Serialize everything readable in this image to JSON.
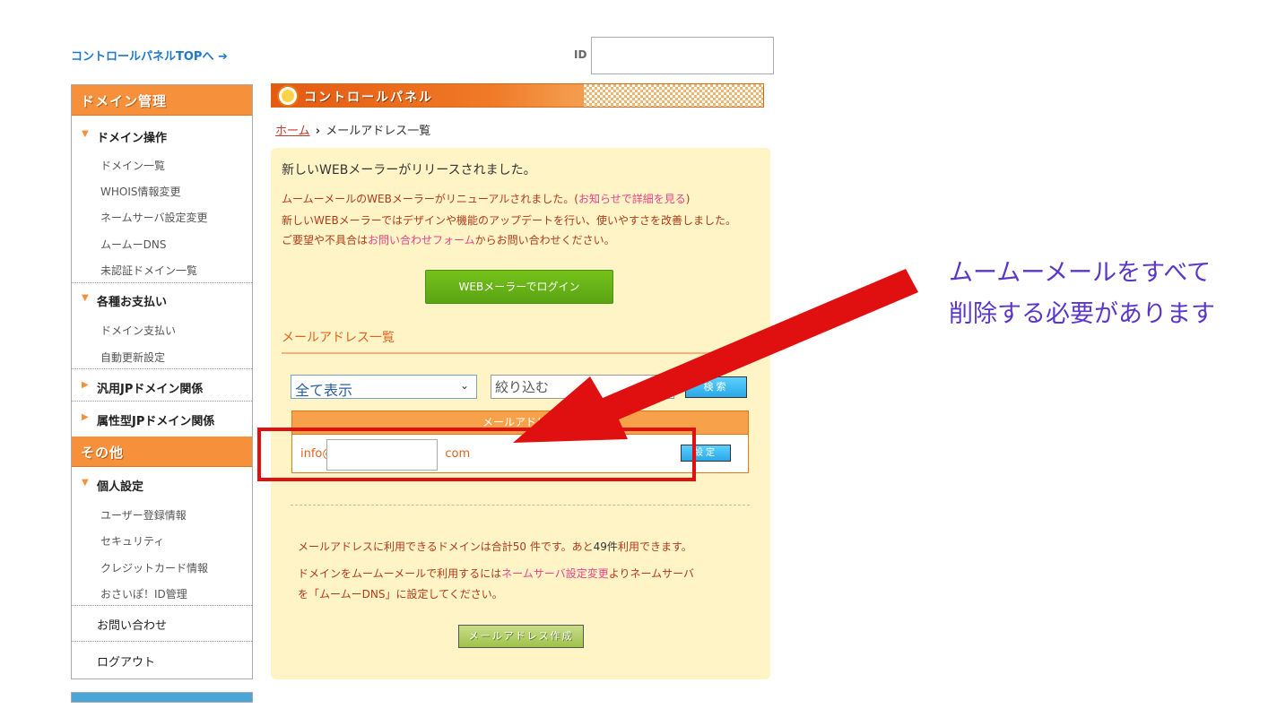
{
  "topbar": {
    "panel_top_link": "コントロールパネルTOPへ ➔",
    "id_label": "ID"
  },
  "sidebar": {
    "domain_header": "ドメイン管理",
    "domain_ops": {
      "label": "ドメイン操作",
      "items": [
        "ドメイン一覧",
        "WHOIS情報変更",
        "ネームサーバ設定変更",
        "ムームーDNS",
        "未認証ドメイン一覧"
      ]
    },
    "payments": {
      "label": "各種お支払い",
      "items": [
        "ドメイン支払い",
        "自動更新設定"
      ]
    },
    "jp_general": "汎用JPドメイン関係",
    "jp_attr": "属性型JPドメイン関係",
    "other_header": "その他",
    "personal": {
      "label": "個人設定",
      "items": [
        "ユーザー登録情報",
        "セキュリティ",
        "クレジットカード情報",
        "おさいぽ！ID管理"
      ]
    },
    "contact": "お問い合わせ",
    "logout": "ログアウト"
  },
  "main": {
    "header_title": "コントロールパネル",
    "breadcrumb": {
      "home": "ホーム",
      "separator": "›",
      "current": "メールアドレス一覧"
    },
    "notice": {
      "title": "新しいWEBメーラーがリリースされました。",
      "line1_a": "ムームーメールのWEBメーラーがリニューアルされました。(",
      "line1_link": "お知らせで詳細を見る",
      "line1_b": ")",
      "line2": "新しいWEBメーラーではデザインや機能のアップデートを行い、使いやすさを改善しました。",
      "line3_a": "ご要望や不具合は",
      "line3_link": "お問い合わせフォーム",
      "line3_b": "からお問い合わせください。"
    },
    "webmail_button": "WEBメーラーでログイン",
    "list_heading": "メールアドレス一覧",
    "filter": {
      "select_value": "全て表示",
      "input_value": "絞り込む",
      "search_button": "検索"
    },
    "table": {
      "header": "メールアドレス",
      "rows": [
        {
          "email_prefix": "info@",
          "email_suffix": "com",
          "action": "設定"
        }
      ]
    },
    "info": {
      "line1_a": "メールアドレスに利用できるドメインは合計50 件です。あと",
      "line1_count": "49件",
      "line1_b": "利用できます。",
      "line2_a": "ドメインをムームーメールで利用するには",
      "line2_link": "ネームサーバ設定変更",
      "line2_b": "よりネームサーバ",
      "line3": "を「ムームーDNS」に設定してください。"
    },
    "create_button": "メールアドレス作成"
  },
  "annotation": {
    "line1": "ムームーメールをすべて",
    "line2": "削除する必要があります",
    "color": "#5b36c8",
    "arrow_color": "#e01010"
  }
}
